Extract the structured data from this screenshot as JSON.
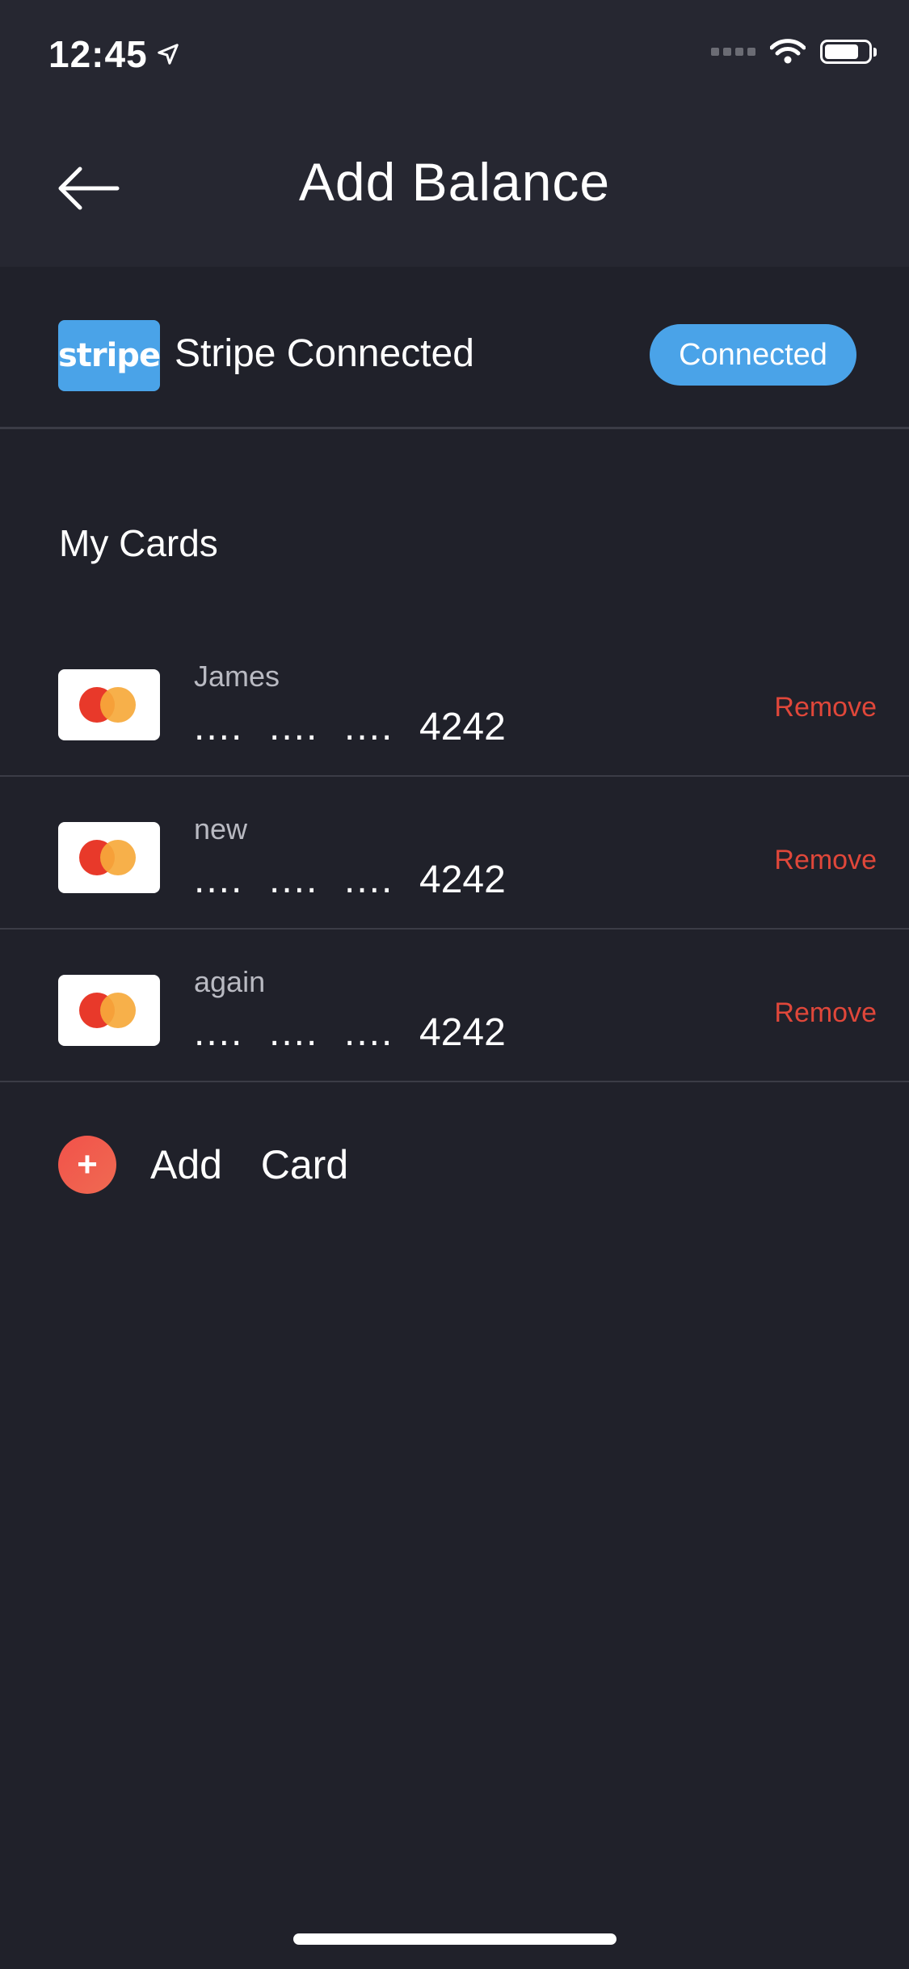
{
  "status_bar": {
    "time": "12:45"
  },
  "header": {
    "title": "Add Balance"
  },
  "stripe": {
    "logo_text": "stripe",
    "label": "Stripe Connected",
    "badge": "Connected"
  },
  "cards_section": {
    "title": "My Cards",
    "cards": [
      {
        "name": "James",
        "masked_groups": [
          "....",
          "....",
          "...."
        ],
        "last4": "4242",
        "remove_label": "Remove"
      },
      {
        "name": "new",
        "masked_groups": [
          "....",
          "....",
          "...."
        ],
        "last4": "4242",
        "remove_label": "Remove"
      },
      {
        "name": "again",
        "masked_groups": [
          "....",
          "....",
          "...."
        ],
        "last4": "4242",
        "remove_label": "Remove"
      }
    ]
  },
  "add_card": {
    "icon": "+",
    "label": "Add  Card"
  },
  "colors": {
    "background": "#20212a",
    "header": "#262731",
    "accent_blue": "#4aa3e8",
    "remove_red": "#e0473a",
    "add_red": "#f2524a"
  },
  "icons": {
    "back": "arrow-left-icon",
    "location": "location-arrow-icon",
    "wifi": "wifi-icon",
    "battery": "battery-icon",
    "card_brand": "mastercard-icon"
  }
}
